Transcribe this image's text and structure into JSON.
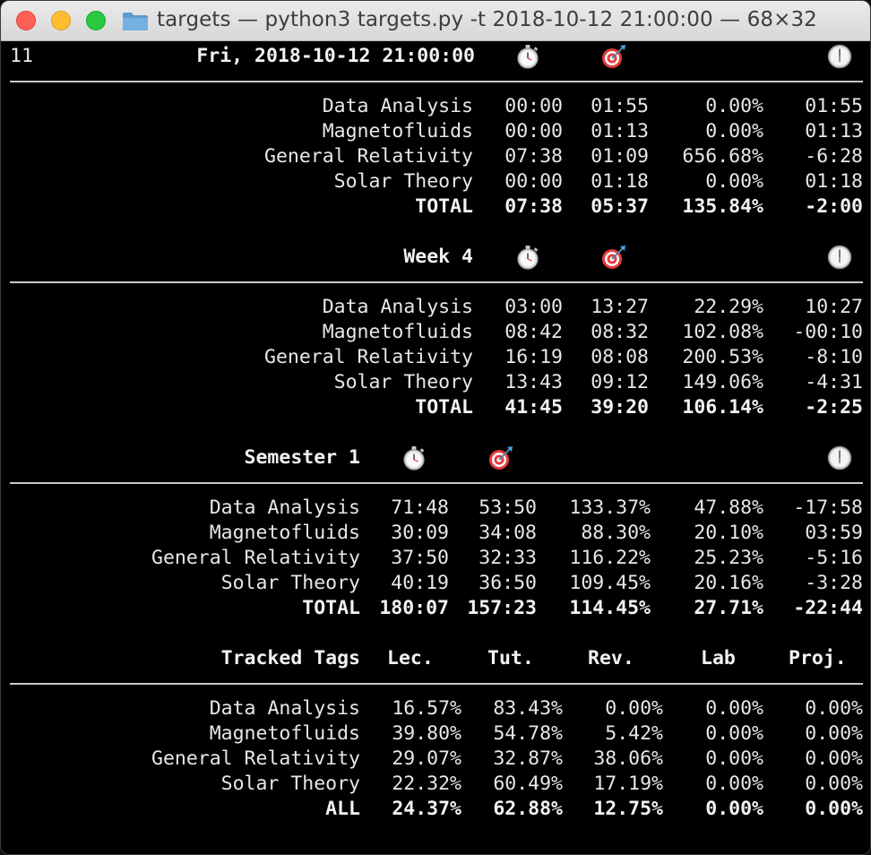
{
  "window": {
    "title": "targets — python3 targets.py -t 2018-10-12 21:00:00 — 68×32",
    "icons": [
      "close-icon",
      "minimize-icon",
      "zoom-icon",
      "folder-icon"
    ]
  },
  "header": {
    "line_no": "11",
    "date": "Fri, 2018-10-12 21:00:00"
  },
  "today": {
    "rows": [
      {
        "name": "Data Analysis",
        "c1": "00:00",
        "c2": "01:55",
        "pct": "0.00%",
        "diff": "01:55"
      },
      {
        "name": "Magnetofluids",
        "c1": "00:00",
        "c2": "01:13",
        "pct": "0.00%",
        "diff": "01:13"
      },
      {
        "name": "General Relativity",
        "c1": "07:38",
        "c2": "01:09",
        "pct": "656.68%",
        "diff": "-6:28"
      },
      {
        "name": "Solar Theory",
        "c1": "00:00",
        "c2": "01:18",
        "pct": "0.00%",
        "diff": "01:18"
      }
    ],
    "total": {
      "name": "TOTAL",
      "c1": "07:38",
      "c2": "05:37",
      "pct": "135.84%",
      "diff": "-2:00"
    }
  },
  "week": {
    "title": "Week 4",
    "rows": [
      {
        "name": "Data Analysis",
        "c1": "03:00",
        "c2": "13:27",
        "pct": "22.29%",
        "diff": "10:27"
      },
      {
        "name": "Magnetofluids",
        "c1": "08:42",
        "c2": "08:32",
        "pct": "102.08%",
        "diff": "-00:10"
      },
      {
        "name": "General Relativity",
        "c1": "16:19",
        "c2": "08:08",
        "pct": "200.53%",
        "diff": "-8:10"
      },
      {
        "name": "Solar Theory",
        "c1": "13:43",
        "c2": "09:12",
        "pct": "149.06%",
        "diff": "-4:31"
      }
    ],
    "total": {
      "name": "TOTAL",
      "c1": "41:45",
      "c2": "39:20",
      "pct": "106.14%",
      "diff": "-2:25"
    }
  },
  "semester": {
    "title": "Semester 1",
    "rows": [
      {
        "name": "Data Analysis",
        "c1": "71:48",
        "c2": "53:50",
        "pct": "133.37%",
        "share": "47.88%",
        "diff": "-17:58"
      },
      {
        "name": "Magnetofluids",
        "c1": "30:09",
        "c2": "34:08",
        "pct": "88.30%",
        "share": "20.10%",
        "diff": "03:59"
      },
      {
        "name": "General Relativity",
        "c1": "37:50",
        "c2": "32:33",
        "pct": "116.22%",
        "share": "25.23%",
        "diff": "-5:16"
      },
      {
        "name": "Solar Theory",
        "c1": "40:19",
        "c2": "36:50",
        "pct": "109.45%",
        "share": "20.16%",
        "diff": "-3:28"
      }
    ],
    "total": {
      "name": "TOTAL",
      "c1": "180:07",
      "c2": "157:23",
      "pct": "114.45%",
      "share": "27.71%",
      "diff": "-22:44"
    }
  },
  "tags": {
    "headers": [
      "Tracked Tags",
      "Lec.",
      "Tut.",
      "Rev.",
      "Lab",
      "Proj."
    ],
    "rows": [
      {
        "name": "Data Analysis",
        "v": [
          "16.57%",
          "83.43%",
          "0.00%",
          "0.00%",
          "0.00%"
        ]
      },
      {
        "name": "Magnetofluids",
        "v": [
          "39.80%",
          "54.78%",
          "5.42%",
          "0.00%",
          "0.00%"
        ]
      },
      {
        "name": "General Relativity",
        "v": [
          "29.07%",
          "32.87%",
          "38.06%",
          "0.00%",
          "0.00%"
        ]
      },
      {
        "name": "Solar Theory",
        "v": [
          "22.32%",
          "60.49%",
          "17.19%",
          "0.00%",
          "0.00%"
        ]
      }
    ],
    "total": {
      "name": "ALL",
      "v": [
        "24.37%",
        "62.88%",
        "12.75%",
        "0.00%",
        "0.00%"
      ]
    }
  },
  "section_icons": [
    "stopwatch-icon",
    "target-dart-icon",
    "clock-icon"
  ]
}
